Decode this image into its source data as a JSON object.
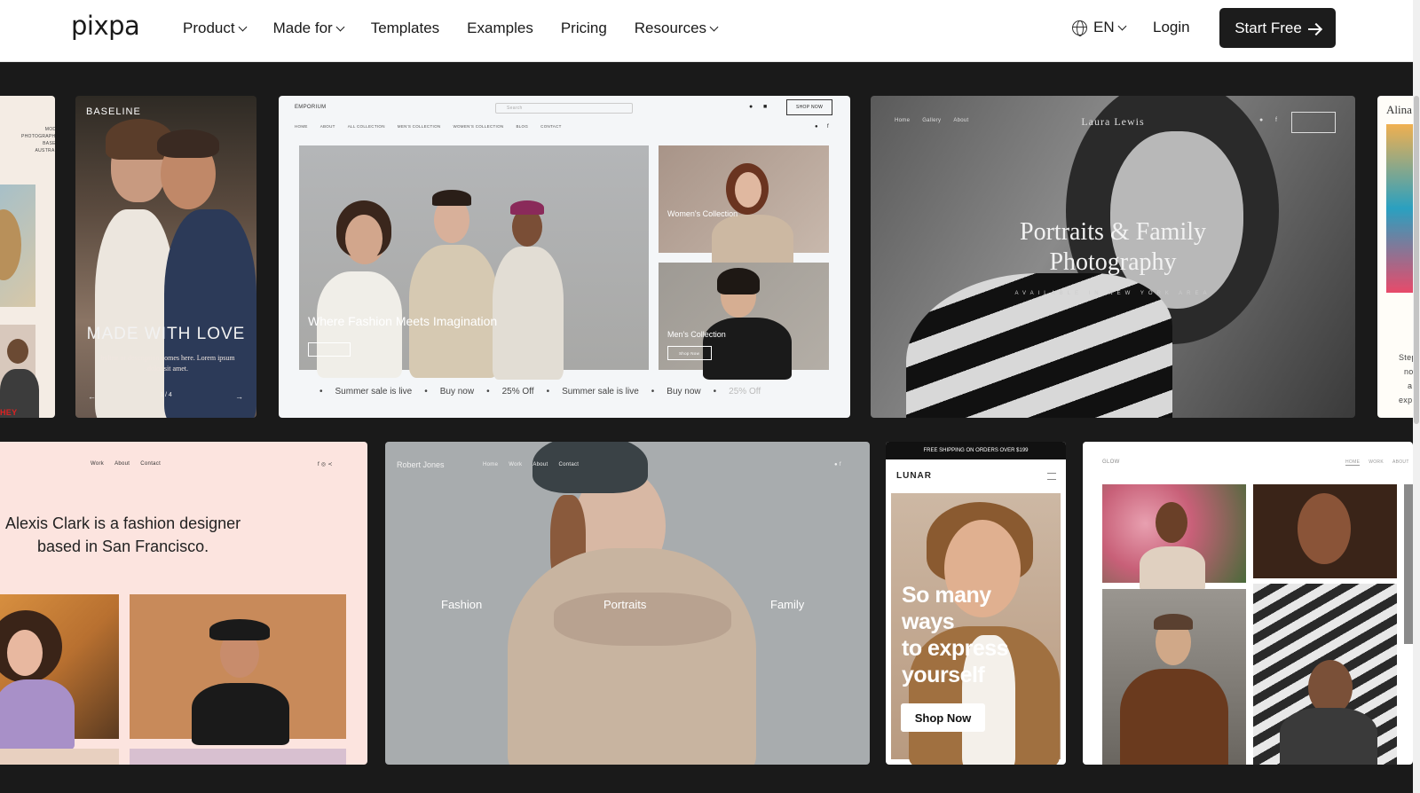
{
  "nav": {
    "logo": "pixpa",
    "links": [
      {
        "label": "Product",
        "dropdown": true
      },
      {
        "label": "Made for",
        "dropdown": true
      },
      {
        "label": "Templates",
        "dropdown": false
      },
      {
        "label": "Examples",
        "dropdown": false
      },
      {
        "label": "Pricing",
        "dropdown": false
      },
      {
        "label": "Resources",
        "dropdown": true
      }
    ],
    "language": "EN",
    "login": "Login",
    "cta": "Start Free"
  },
  "templates": {
    "partial_left": {
      "lines": [
        "MODEL",
        "PHOTOGRAPHER",
        "BASE IN AUSTRALIA"
      ],
      "badge": "HEY"
    },
    "baseline": {
      "brand": "BASELINE",
      "headline": "MADE WITH LOVE",
      "sub": "byline or description comes here. Lorem ipsum dolor sit amet.",
      "pager": "1 / 4"
    },
    "emporium": {
      "brand": "EMPORIUM",
      "search": "Search",
      "shop_btn": "SHOP NOW",
      "menu": [
        "HOME",
        "ABOUT",
        "ALL COLLECTION",
        "MEN'S COLLECTION",
        "WOMEN'S COLLECTION",
        "BLOG",
        "CONTACT"
      ],
      "hero_text": "Where Fashion Meets Imagination",
      "women": "Women's Collection",
      "men": "Men's Collection",
      "men_btn": "Shop Now",
      "ticker": [
        "Summer sale is live",
        "Buy now",
        "25% Off",
        "Summer sale is live",
        "Buy now",
        "25% Off"
      ]
    },
    "laura": {
      "nav": [
        "Home",
        "Gallery",
        "About"
      ],
      "name": "Laura Lewis",
      "title_line1": "Portraits & Family",
      "title_line2": "Photography",
      "sub": "AVAILABLE IN NEW YORK AREA"
    },
    "alina": {
      "name": "Alina",
      "lines": [
        "Step",
        "no",
        "a",
        "exp"
      ]
    },
    "alexis": {
      "nav": [
        "Work",
        "About",
        "Contact"
      ],
      "headline_line1": "Alexis Clark is a fashion designer",
      "headline_line2": "based in San Francisco."
    },
    "robert": {
      "name": "Robert Jones",
      "nav": [
        "Home",
        "Work",
        "About",
        "Contact"
      ],
      "labels": [
        "Fashion",
        "Portraits",
        "Family"
      ]
    },
    "lunar": {
      "banner": "FREE SHIPPING ON ORDERS OVER $199",
      "brand": "LUNAR",
      "headline": [
        "So many",
        "ways",
        "to express",
        "yourself"
      ],
      "cta": "Shop Now"
    },
    "glow": {
      "brand": "GLOW",
      "nav": [
        "HOME",
        "WORK",
        "ABOUT"
      ]
    }
  }
}
